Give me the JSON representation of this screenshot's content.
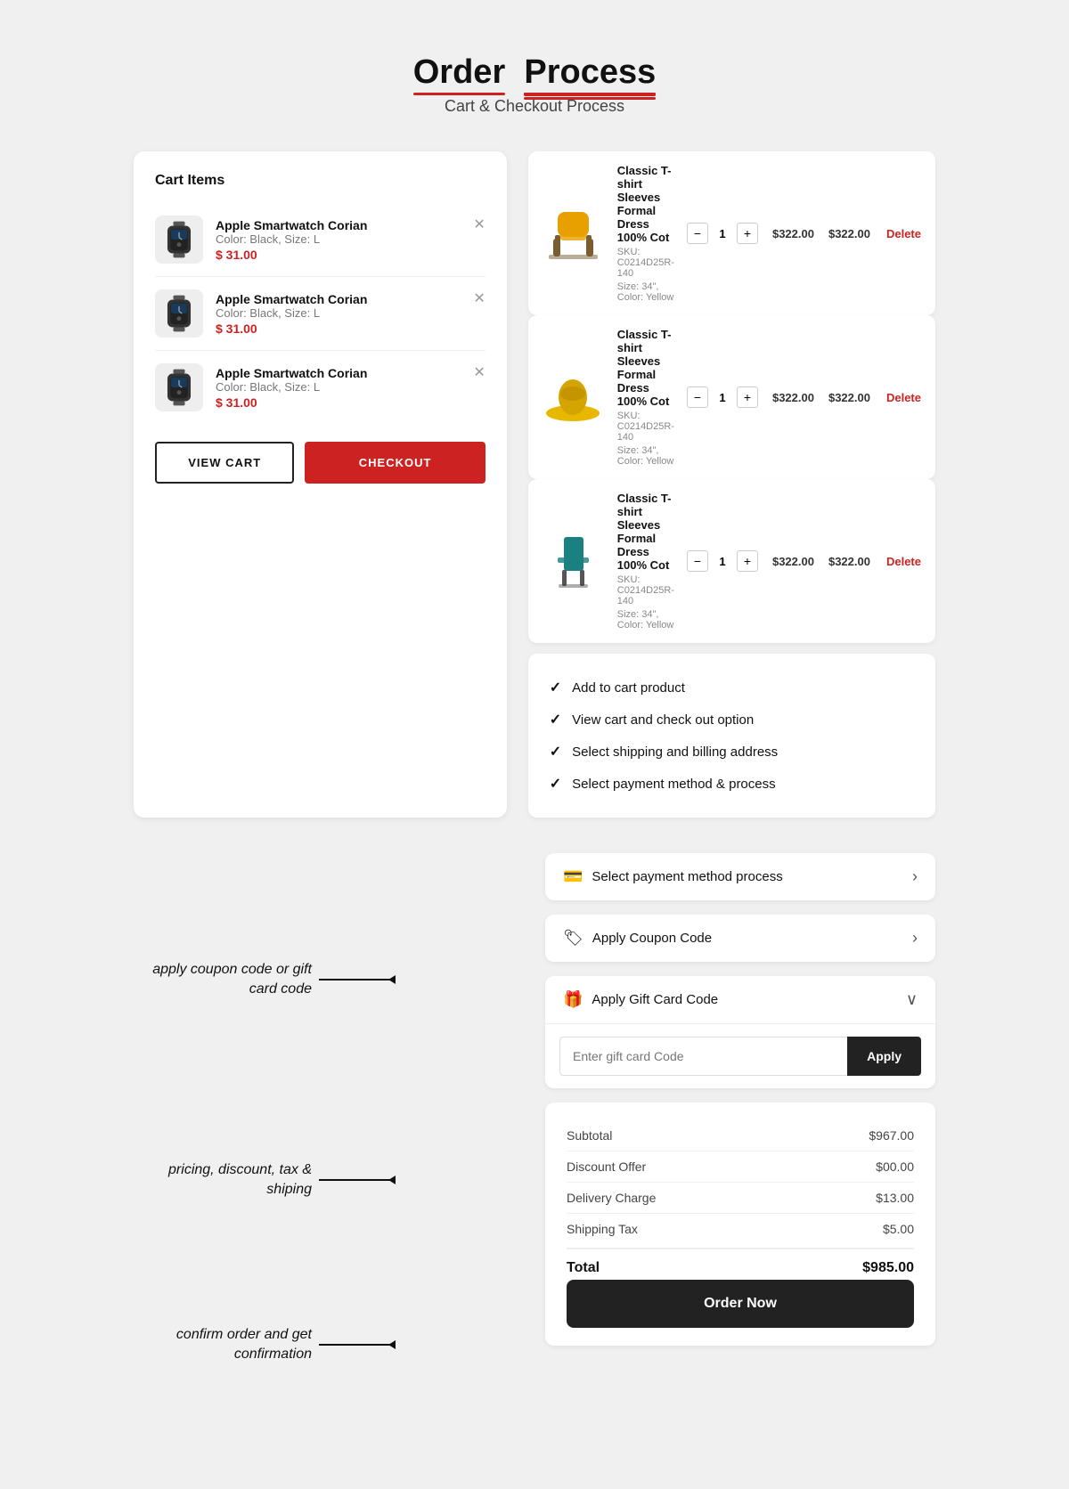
{
  "page": {
    "title": "Order",
    "title_highlight": "Process",
    "subtitle": "Cart & Checkout Process"
  },
  "cart": {
    "panel_title": "Cart Items",
    "items": [
      {
        "name": "Apple Smartwatch Corian",
        "meta": "Color: Black, Size: L",
        "price": "$ 31.00"
      },
      {
        "name": "Apple Smartwatch Corian",
        "meta": "Color: Black, Size: L",
        "price": "$ 31.00"
      },
      {
        "name": "Apple Smartwatch Corian",
        "meta": "Color: Black, Size: L",
        "price": "$ 31.00"
      }
    ],
    "view_cart_label": "VIEW CART",
    "checkout_label": "CHECKOUT"
  },
  "products": [
    {
      "name": "Classic T-shirt Sleeves Formal Dress 100% Cot",
      "sku": "SKU: C0214D25R-140",
      "size_color": "Size: 34\", Color: Yellow",
      "qty": 1,
      "price": "$322.00",
      "total": "$322.00",
      "delete_label": "Delete",
      "color": "#E8A000"
    },
    {
      "name": "Classic T-shirt Sleeves Formal Dress 100% Cot",
      "sku": "SKU: C0214D25R-140",
      "size_color": "Size: 34\", Color: Yellow",
      "qty": 1,
      "price": "$322.00",
      "total": "$322.00",
      "delete_label": "Delete",
      "color": "#D4AA00"
    },
    {
      "name": "Classic T-shirt Sleeves Formal Dress 100% Cot",
      "sku": "SKU: C0214D25R-140",
      "size_color": "Size: 34\", Color: Yellow",
      "qty": 1,
      "price": "$322.00",
      "total": "$322.00",
      "delete_label": "Delete",
      "color": "#1B8080"
    }
  ],
  "features": [
    "Add to cart product",
    "View cart and check out option",
    "Select shipping and billing address",
    "Select payment method & process"
  ],
  "annotations": {
    "coupon": "apply coupon code or gift card code",
    "pricing": "pricing, discount, tax & shiping",
    "confirm": "confirm order and get confirmation"
  },
  "right_panel": {
    "select_payment_label": "Select payment method process",
    "coupon": {
      "label": "Apply Coupon Code",
      "chevron": "›"
    },
    "gift_card": {
      "label": "Apply Gift Card Code",
      "placeholder": "Enter gift card Code",
      "apply_label": "Apply",
      "chevron": "∨"
    }
  },
  "pricing": {
    "rows": [
      {
        "label": "Subtotal",
        "value": "$967.00"
      },
      {
        "label": "Discount Offer",
        "value": "$00.00"
      },
      {
        "label": "Delivery Charge",
        "value": "$13.00"
      },
      {
        "label": "Shipping Tax",
        "value": "$5.00"
      }
    ],
    "total_label": "Total",
    "total_value": "$985.00",
    "order_now_label": "Order Now"
  }
}
